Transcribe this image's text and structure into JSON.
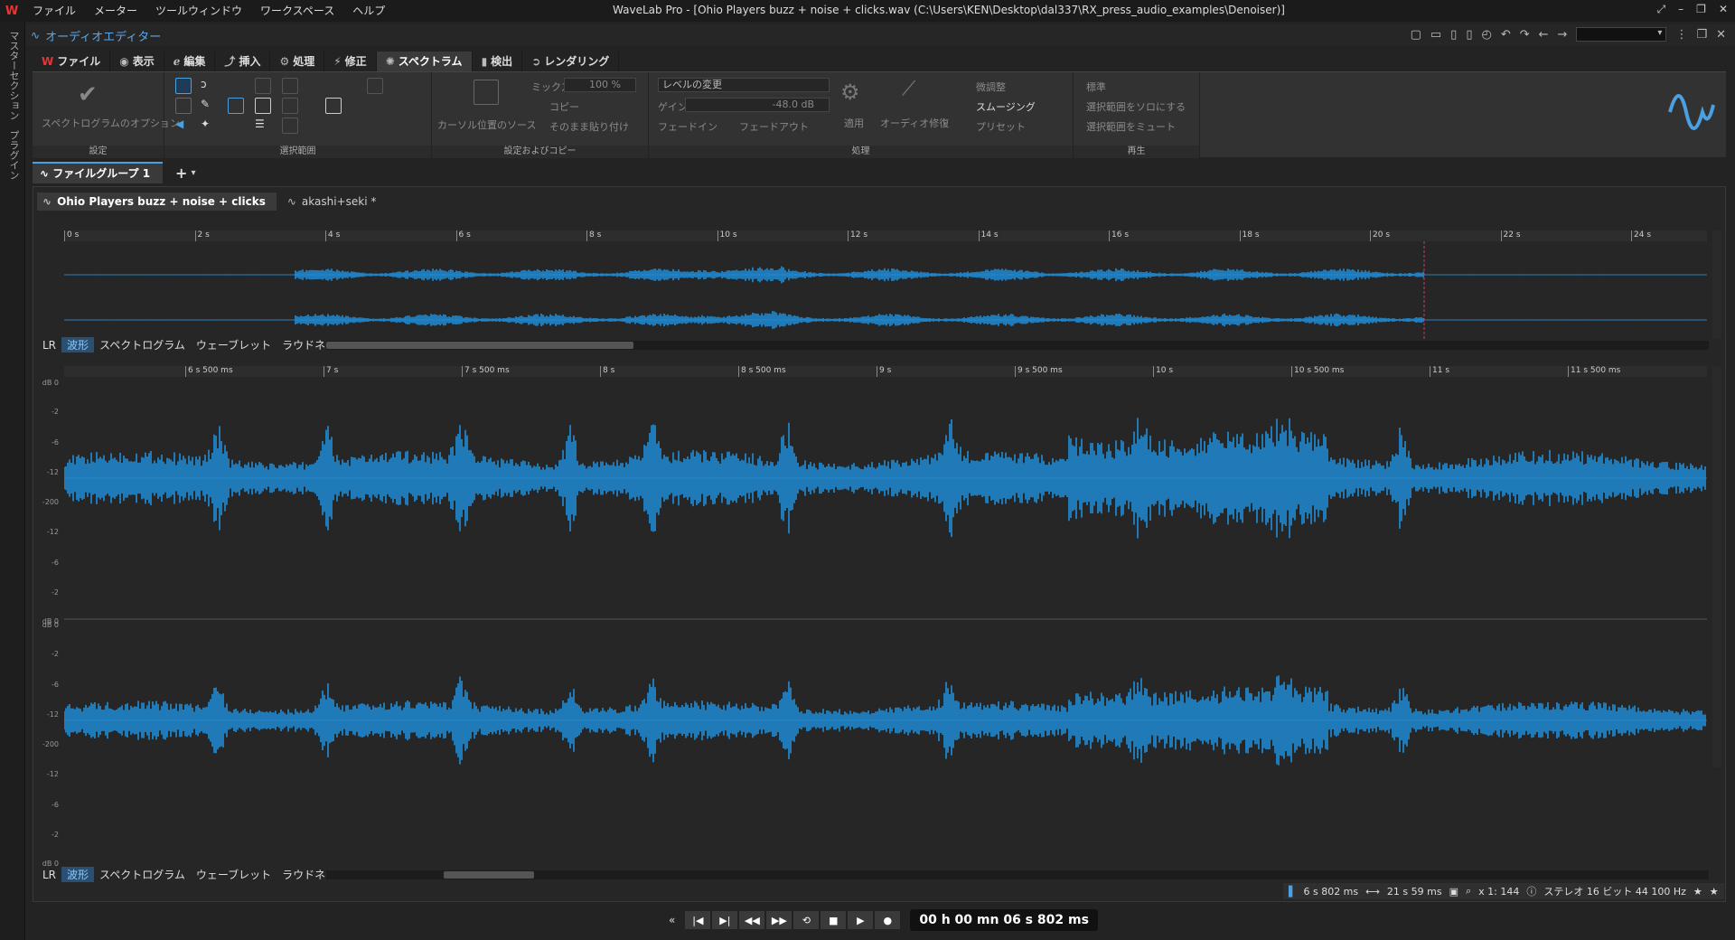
{
  "window": {
    "title": "WaveLab Pro - [Ohio Players buzz + noise + clicks.wav (C:\\Users\\KEN\\Desktop\\dal337\\RX_press_audio_examples\\Denoiser)]",
    "logo": "W"
  },
  "menu": [
    "ファイル",
    "メーター",
    "ツールウィンドウ",
    "ワークスペース",
    "ヘルプ"
  ],
  "left_strip": {
    "meters": "マスターセクション",
    "plugins": "プラグイン"
  },
  "editor_title": "オーディオエディター",
  "ribbon_tabs": [
    {
      "label": "ファイル"
    },
    {
      "label": "表示"
    },
    {
      "label": "編集"
    },
    {
      "label": "挿入"
    },
    {
      "label": "処理"
    },
    {
      "label": "修正"
    },
    {
      "label": "スペクトラム",
      "active": true
    },
    {
      "label": "検出"
    },
    {
      "label": "レンダリング"
    }
  ],
  "ribbon": {
    "settings": {
      "button": "スペクトログラムのオプション",
      "label": "設定"
    },
    "selection": {
      "label": "選択範囲"
    },
    "source": {
      "cursor_source": "カーソル位置のソース",
      "mix_label": "ミックス",
      "mix_value": "100 %",
      "copy": "コピー",
      "paste": "そのまま貼り付け",
      "label": "設定およびコピー"
    },
    "process": {
      "level_change": "レベルの変更",
      "gain_label": "ゲイン",
      "gain_value": "-48.0 dB",
      "fade_in": "フェードイン",
      "fade_out": "フェードアウト",
      "apply": "適用",
      "audio_repair": "オーディオ修復",
      "fine_adjust": "微調整",
      "smoothing": "スムージング",
      "preset": "プリセット",
      "label": "処理"
    },
    "playback": {
      "standard": "標準",
      "solo": "選択範囲をソロにする",
      "mute": "選択範囲をミュート",
      "label": "再生"
    }
  },
  "file_group": {
    "label": "ファイルグループ 1",
    "add": "+"
  },
  "doc_tabs": [
    {
      "label": "Ohio Players buzz + noise + clicks",
      "active": true
    },
    {
      "label": "akashi+seki *"
    }
  ],
  "overview_ticks": [
    "0 s",
    "2 s",
    "4 s",
    "6 s",
    "8 s",
    "10 s",
    "12 s",
    "14 s",
    "16 s",
    "18 s",
    "20 s",
    "22 s",
    "24 s"
  ],
  "main_ticks": [
    "6 s 500 ms",
    "7 s",
    "7 s 500 ms",
    "8 s",
    "8 s 500 ms",
    "9 s",
    "9 s 500 ms",
    "10 s",
    "10 s 500 ms",
    "11 s",
    "11 s 500 ms"
  ],
  "db_labels": [
    "dB 0",
    "-2",
    "-6",
    "-12",
    "-200",
    "-12",
    "-6",
    "-2",
    "dB 0"
  ],
  "view_modes": {
    "lr": "LR",
    "waveform": "波形",
    "spectrogram": "スペクトログラム",
    "wavelet": "ウェーブレット",
    "loudness": "ラウドネス"
  },
  "status": {
    "cursor": "6 s 802 ms",
    "length": "21 s 59 ms",
    "zoom": "x 1: 144",
    "format": "ステレオ 16 ビット 44 100 Hz"
  },
  "timecode": "00 h 00 mn 06 s 802 ms",
  "colors": {
    "waveform": "#1e8fdc",
    "accent": "#4aa0e0",
    "background": "#262626"
  }
}
